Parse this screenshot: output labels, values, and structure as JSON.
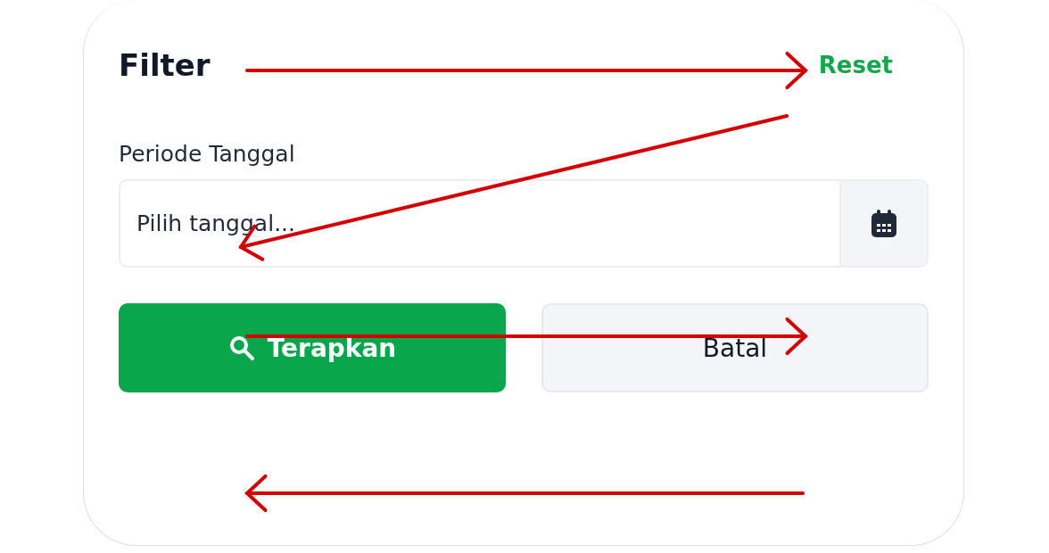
{
  "filter": {
    "title": "Filter",
    "reset": "Reset"
  },
  "date_field": {
    "label": "Periode Tanggal",
    "placeholder": "Pilih tanggal..."
  },
  "buttons": [
    {
      "label": "Terapkan",
      "kind": "primary"
    },
    {
      "label": "Batal",
      "kind": "secondary"
    }
  ]
}
